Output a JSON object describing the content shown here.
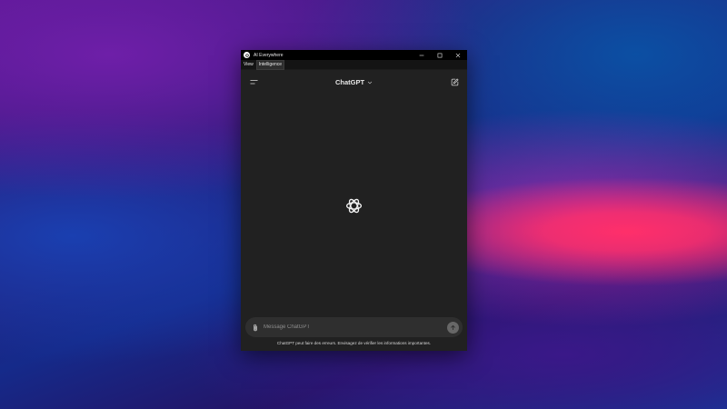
{
  "window": {
    "title": "AI Everywhere"
  },
  "menubar": {
    "items": [
      {
        "label": "View"
      },
      {
        "label": "Intelligence",
        "active": true
      }
    ]
  },
  "header": {
    "model_label": "ChatGPT",
    "model_dropdown_icon": "chevron-down-icon",
    "left_icon": "sidebar-toggle-icon",
    "right_icon": "new-chat-icon"
  },
  "main": {
    "logo_icon": "openai-logo-icon"
  },
  "composer": {
    "placeholder": "Message ChatGPT",
    "value": "",
    "attach_icon": "paperclip-icon",
    "send_icon": "arrow-up-icon"
  },
  "footer": {
    "disclaimer": "ChatGPT peut faire des erreurs. Envisagez de vérifier les informations importantes."
  },
  "colors": {
    "window_bg": "#212121",
    "titlebar_bg": "#000000",
    "composer_bg": "#2f2f2f",
    "send_bg": "#676767"
  }
}
